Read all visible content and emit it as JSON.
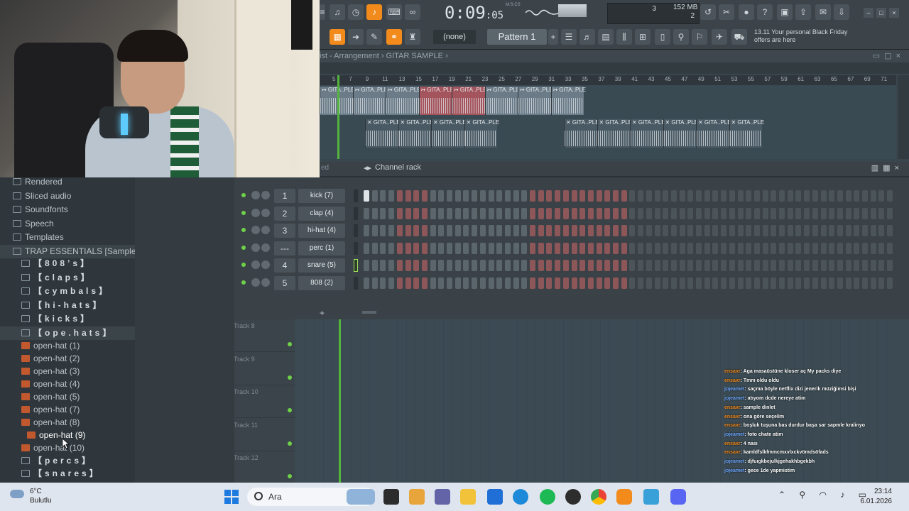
{
  "toolbar": {
    "time_main": "0:09",
    "time_sub": ":05",
    "time_unit": "M:S:CS",
    "pattern_select": "(none)",
    "pattern_label": "Pattern 1",
    "cpu_value": "3",
    "memory_value": "152 MB",
    "polyphony_value": "2",
    "news_text": "13.11  Your personal Black Friday offers are here"
  },
  "playlist": {
    "title": "ist - Arrangement › GITAR SAMPLE ›",
    "ruler": [
      "5",
      "7",
      "9",
      "11",
      "13",
      "15",
      "17",
      "19",
      "21",
      "23",
      "25",
      "27",
      "29",
      "31",
      "33",
      "35",
      "37",
      "39",
      "41",
      "43",
      "45",
      "47",
      "49",
      "51",
      "53",
      "55",
      "57",
      "59",
      "61",
      "63",
      "65",
      "67",
      "69",
      "71"
    ],
    "clip_labels": [
      "↣ GITA..PLE",
      "↣ GITA..PLE",
      "↣ GITA..PLE",
      "↣ GITA..PLE",
      "↣ GITA..PLE",
      "↣ GITA..PLE",
      "↣ GITA..PLE",
      "↣ GITA..PLE"
    ],
    "clip2_labels": [
      "✕ GITA..PLE",
      "✕ GITA..PLE",
      "✕ GITA..PLE",
      "✕ GITA..PLE"
    ],
    "clip3_labels": [
      "✕ GITA..PLE",
      "✕ GITA..PLE",
      "✕ GITA..PLE",
      "✕ GITA..PLE",
      "✕ GITA..PLE",
      "✕ GITA..PLE"
    ]
  },
  "channel_rack": {
    "title": "Channel rack",
    "side_label": "ed",
    "channels": [
      {
        "num": "1",
        "name": "kick (7)"
      },
      {
        "num": "2",
        "name": "clap (4)"
      },
      {
        "num": "3",
        "name": "hi-hat (4)"
      },
      {
        "num": "---",
        "name": "perc (1)"
      },
      {
        "num": "4",
        "name": "snare (5)"
      },
      {
        "num": "5",
        "name": "808 (2)"
      }
    ],
    "add_label": "+"
  },
  "tracks": [
    "Track 8",
    "Track 9",
    "Track 10",
    "Track 11",
    "Track 12"
  ],
  "browser": {
    "items": [
      {
        "label": "Rendered"
      },
      {
        "label": "Sliced audio"
      },
      {
        "label": "Soundfonts"
      },
      {
        "label": "Speech"
      },
      {
        "label": "Templates"
      },
      {
        "label": "TRAP ESSENTIALS [Sample Pack]"
      },
      {
        "label": "【808’s】"
      },
      {
        "label": "【claps】"
      },
      {
        "label": "【cymbals】"
      },
      {
        "label": "【hi-hats】"
      },
      {
        "label": "【kicks】"
      },
      {
        "label": "【ope.hats】"
      },
      {
        "label": "open-hat (1)"
      },
      {
        "label": "open-hat (2)"
      },
      {
        "label": "open-hat (3)"
      },
      {
        "label": "open-hat (4)"
      },
      {
        "label": "open-hat (5)"
      },
      {
        "label": "open-hat (7)"
      },
      {
        "label": "open-hat (8)"
      },
      {
        "label": "open-hat (9)"
      },
      {
        "label": "open-hat (10)"
      },
      {
        "label": "【percs】"
      },
      {
        "label": "【snares】"
      }
    ]
  },
  "chat": [
    {
      "user": "ensaxr",
      "msg": ": Aga masaüstüne kloser aç My packs diye"
    },
    {
      "user": "ensaxr",
      "msg": ": Tmm oldu oldu"
    },
    {
      "user": "jojeamet",
      "msg": ": saçma böyle netflix dizi jenerik müziğimsi bişi"
    },
    {
      "user": "jojeamet",
      "msg": ": atıyom dcde nereye atim"
    },
    {
      "user": "ensaxr",
      "msg": ": sample dinlet"
    },
    {
      "user": "ensaxr",
      "msg": ": ona göre seçelim"
    },
    {
      "user": "ensaxr",
      "msg": ": boşluk tuşuna bas durdur başa sar sapmle kralinyo"
    },
    {
      "user": "jojeamet",
      "msg": ": foto chate atim"
    },
    {
      "user": "ensaxr",
      "msg": ": 4 nası"
    },
    {
      "user": "ensaxr",
      "msg": ": kamldfslkfmmcmxvlxckvömdsöfads"
    },
    {
      "user": "jojeamet",
      "msg": ": djfuıgkbejulkjgehakhbgekbh"
    },
    {
      "user": "jojeamet",
      "msg": ": gece 1de yapmistim"
    }
  ],
  "taskbar": {
    "weather_temp": "6°C",
    "weather_desc": "Bulutlu",
    "search_placeholder": "Ara",
    "time": "23:14",
    "date": "6.01.2026"
  },
  "colors": {
    "accent": "#f28a1c",
    "led_green": "#6fd149",
    "step_red": "#8d5659"
  }
}
